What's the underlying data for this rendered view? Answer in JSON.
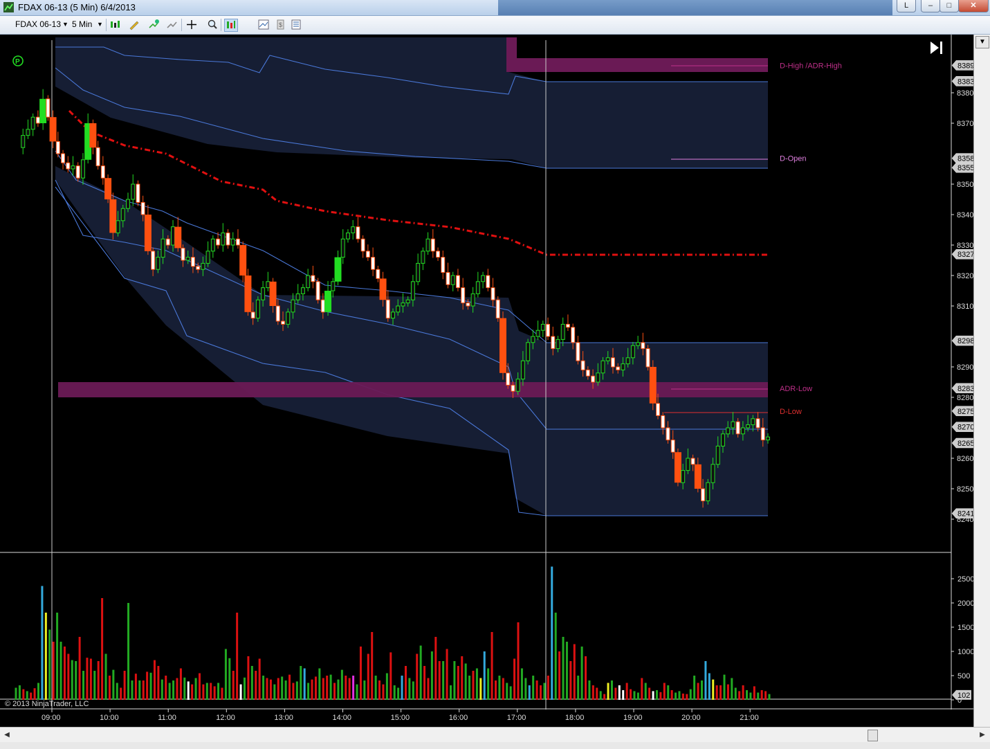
{
  "window": {
    "title": "FDAX 06-13 (5 Min)  6/4/2013",
    "buttons": {
      "l": "L",
      "minimize": "–",
      "maximize": "□",
      "close": "✕"
    }
  },
  "toolbar": {
    "instrument": "FDAX 06-13",
    "interval": "5 Min",
    "icons": [
      "candlestick-style-icon",
      "pencil-draw-icon",
      "add-indicator-icon",
      "strategy-icon",
      "crosshair-icon",
      "zoom-icon",
      "data-box-icon",
      "chart-properties-icon",
      "price-marker-icon",
      "properties-icon"
    ]
  },
  "chart": {
    "play_icon": "P",
    "copyright": "© 2013 NinjaTrader, LLC",
    "price_ticks": [
      "8380.0",
      "8370.0",
      "8350.0",
      "8340.0",
      "8330.0",
      "8320.0",
      "8310.0",
      "8290.0",
      "8280.0",
      "8260.0",
      "8250.0",
      "8240.0"
    ],
    "price_markers": [
      {
        "label": "8389.0",
        "price": 8389.0,
        "color": "#c0c0c0"
      },
      {
        "label": "8383.8",
        "price": 8383.8,
        "color": "#c0c0c0"
      },
      {
        "label": "8358.5",
        "price": 8358.5,
        "color": "#c0c0c0"
      },
      {
        "label": "8355.4",
        "price": 8355.4,
        "color": "#c0c0c0"
      },
      {
        "label": "8327.0",
        "price": 8327.0,
        "color": "#c0c0c0"
      },
      {
        "label": "8298.6",
        "price": 8298.6,
        "color": "#c0c0c0"
      },
      {
        "label": "8283.0",
        "price": 8283.0,
        "color": "#c0c0c0"
      },
      {
        "label": "8275.5",
        "price": 8275.5,
        "color": "#c0c0c0"
      },
      {
        "label": "8270.3",
        "price": 8270.3,
        "color": "#c0c0c0"
      },
      {
        "label": "8265.0",
        "price": 8265.0,
        "color": "#c0c0c0"
      },
      {
        "label": "8241.9",
        "price": 8241.9,
        "color": "#c0c0c0"
      }
    ],
    "level_labels": [
      {
        "text": "D-High /ADR-High",
        "price": 8389.0,
        "color": "#c0308a"
      },
      {
        "text": "D-Open",
        "price": 8358.5,
        "color": "#e080e0"
      },
      {
        "text": "ADR-Low",
        "price": 8283.0,
        "color": "#c0308a"
      },
      {
        "text": "D-Low",
        "price": 8275.5,
        "color": "#e03030"
      }
    ],
    "volume_ticks": [
      "2500",
      "2000",
      "1500",
      "1000",
      "500",
      "0"
    ],
    "volume_last": "102",
    "time_ticks": [
      "09:00",
      "10:00",
      "11:00",
      "12:00",
      "13:00",
      "14:00",
      "15:00",
      "16:00",
      "17:00",
      "18:00",
      "19:00",
      "20:00",
      "21:00"
    ],
    "colors": {
      "up": "#22dd22",
      "down": "#ff5010",
      "band_fill": "#18213a",
      "band_line": "#4a78d8",
      "vwap": "#e01010",
      "adr_zone": "#6a1a55"
    }
  }
}
